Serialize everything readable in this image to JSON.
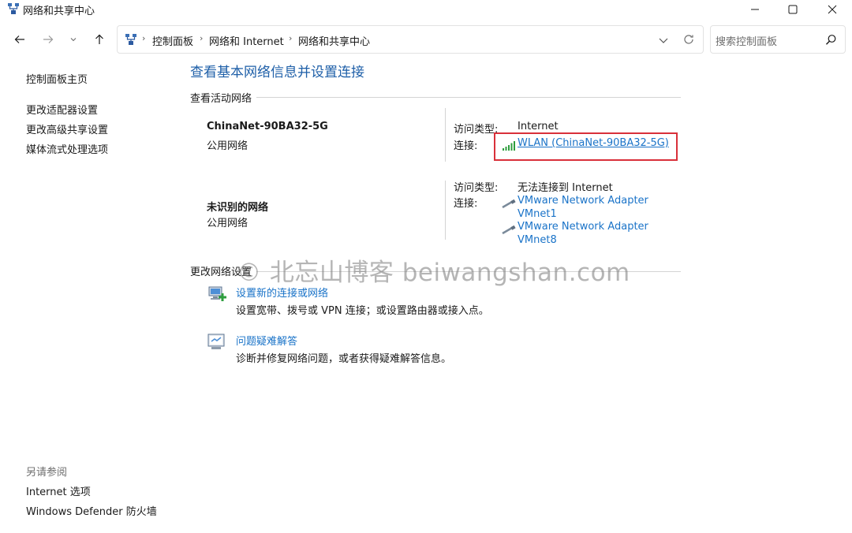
{
  "window": {
    "title": "网络和共享中心"
  },
  "address": {
    "crumbs": [
      "控制面板",
      "网络和 Internet",
      "网络和共享中心"
    ],
    "search_placeholder": "搜索控制面板"
  },
  "sidebar": {
    "home": "控制面板主页",
    "links": [
      "更改适配器设置",
      "更改高级共享设置",
      "媒体流式处理选项"
    ],
    "see_also_heading": "另请参阅",
    "see_also": [
      "Internet 选项",
      "Windows Defender 防火墙"
    ]
  },
  "main": {
    "title": "查看基本网络信息并设置连接",
    "active_networks_label": "查看活动网络",
    "networks": [
      {
        "name": "ChinaNet-90BA32-5G",
        "type": "公用网络",
        "access_label": "访问类型:",
        "access_value": "Internet",
        "conn_label": "连接:",
        "connections": [
          "WLAN (ChinaNet-90BA32-5G)"
        ]
      },
      {
        "name": "未识别的网络",
        "type": "公用网络",
        "access_label": "访问类型:",
        "access_value": "无法连接到 Internet",
        "conn_label": "连接:",
        "connections": [
          {
            "line1": "VMware Network Adapter",
            "line2": "VMnet1"
          },
          {
            "line1": "VMware Network Adapter",
            "line2": "VMnet8"
          }
        ]
      }
    ],
    "change_settings_label": "更改网络设置",
    "tasks": [
      {
        "link": "设置新的连接或网络",
        "desc": "设置宽带、拨号或 VPN 连接；或设置路由器或接入点。"
      },
      {
        "link": "问题疑难解答",
        "desc": "诊断并修复网络问题，或者获得疑难解答信息。"
      }
    ]
  },
  "watermark": "© 北忘山博客 beiwangshan.com",
  "colors": {
    "link": "#1a73c8",
    "title": "#1e5fa8",
    "highlight": "#d9303a"
  }
}
